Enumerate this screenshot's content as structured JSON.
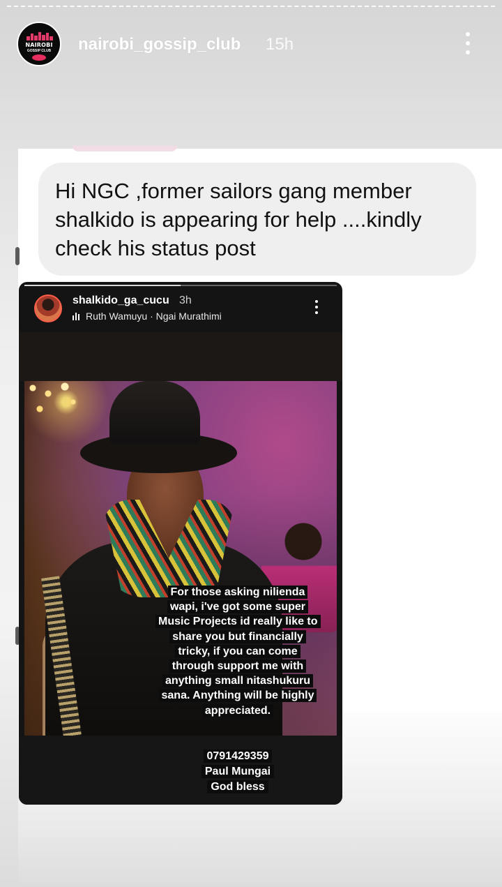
{
  "story": {
    "username": "nairobi_gossip_club",
    "time": "15h",
    "avatar_title": "NAIROBI",
    "avatar_subtitle": "GOSSIP CLUB",
    "icons": {
      "more": "more-vertical-icon"
    }
  },
  "message": {
    "text": "Hi NGC ,former sailors gang member\nshalkido is appearing for help ....kindly\ncheck his status post"
  },
  "shared_story": {
    "username": "shalkido_ga_cucu",
    "time": "3h",
    "music": "Ruth Wamuyu · Ngai Murathimi",
    "progress_fraction": 0.5,
    "caption": "For those asking nilienda wapi, i've got some super Music Projects id really like to share you but financially tricky, if you can come through support me with anything small nitashukuru sana. Anything will be highly appreciated.",
    "contact": "0791429359\nPaul Mungai\nGod bless"
  },
  "colors": {
    "accent_ring": "#ff5c4a",
    "brand_pink": "#e23b6a"
  }
}
